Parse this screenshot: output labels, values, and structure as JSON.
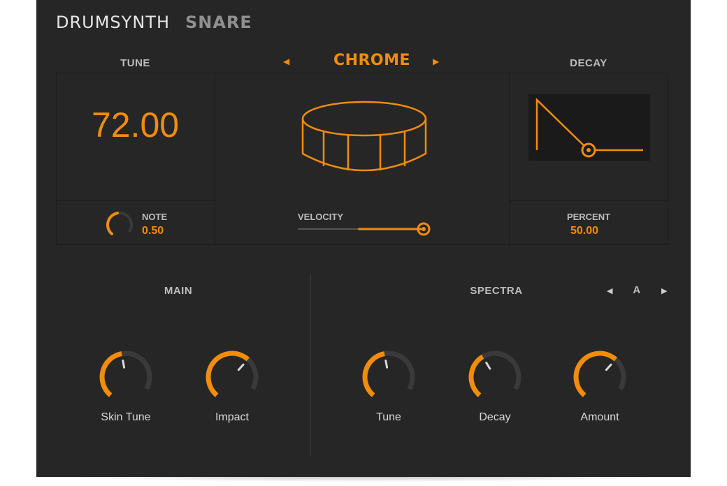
{
  "brand": {
    "name": "DRUMSYNTH",
    "instrument": "SNARE"
  },
  "tune": {
    "label": "TUNE",
    "value": "72.00",
    "note_label": "NOTE",
    "note_value": "0.50",
    "note_level": 0.5
  },
  "preset": {
    "name": "CHROME",
    "prev_icon": "triangle-left-icon",
    "next_icon": "triangle-right-icon"
  },
  "velocity": {
    "label": "VELOCITY",
    "level": 0.48
  },
  "decay": {
    "label": "DECAY",
    "percent_label": "PERCENT",
    "percent_value": "50.00",
    "level": 0.5
  },
  "main": {
    "title": "MAIN",
    "knobs": [
      {
        "label": "Skin Tune",
        "level": 0.5
      },
      {
        "label": "Impact",
        "level": 0.7
      }
    ]
  },
  "spectra": {
    "title": "SPECTRA",
    "selection": "A",
    "knobs": [
      {
        "label": "Tune",
        "level": 0.5
      },
      {
        "label": "Decay",
        "level": 0.42
      },
      {
        "label": "Amount",
        "level": 0.7
      }
    ]
  },
  "colors": {
    "accent": "#f28c0d",
    "background": "#262626",
    "track": "#3a3a3a",
    "text": "#d8d8d8"
  }
}
